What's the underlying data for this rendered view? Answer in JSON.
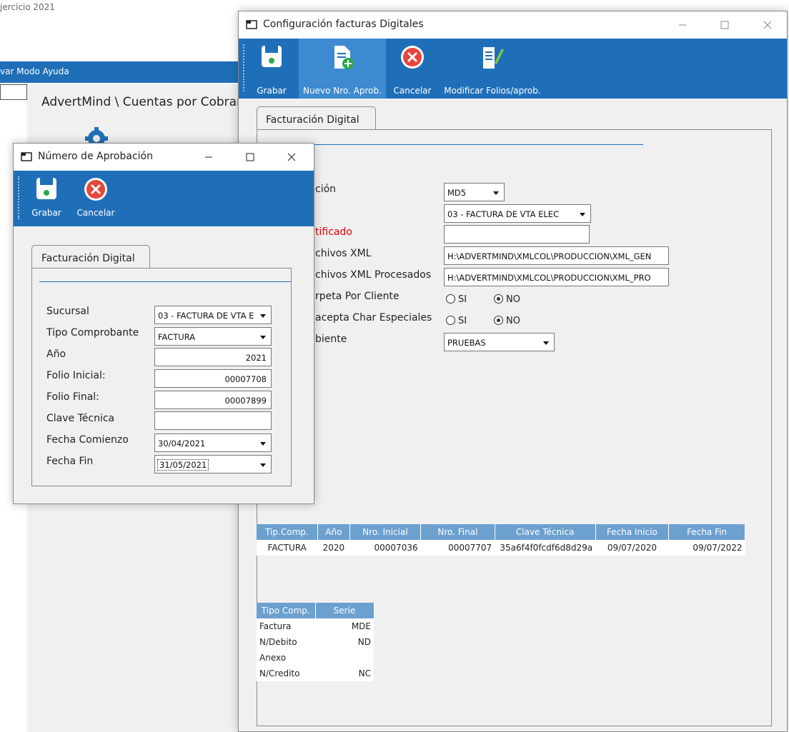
{
  "background_app": {
    "title_fragment": "jercicio 2021",
    "menu_fragment": "var Modo Ayuda",
    "breadcrumb": "AdvertMind \\ Cuentas por Cobrar"
  },
  "config_window": {
    "title": "Configuración facturas Digitales",
    "toolbar": {
      "grabar": "Grabar",
      "nuevo": "Nuevo Nro. Aprob.",
      "cancelar": "Cancelar",
      "modificar": "Modificar Folios/aprob."
    },
    "tab_label": "Facturación Digital",
    "labels": {
      "encriptacion": "ción",
      "certificado": "tificado",
      "archivos_xml": "chivos XML",
      "archivos_xml_procesados": "chivos XML Procesados",
      "carpeta_por_cliente": "rpeta Por Cliente",
      "acepta_char": "acepta Char Especiales",
      "ambiente": "biente"
    },
    "values": {
      "encriptacion": "MD5",
      "sucursal": "03 - FACTURA DE VTA ELEC",
      "certificado": "",
      "archivos_xml": "H:\\ADVERTMIND\\XMLCOL\\PRODUCCION\\XML_GEN",
      "archivos_xml_procesados": "H:\\ADVERTMIND\\XMLCOL\\PRODUCCION\\XML_PRO",
      "si_label": "SI",
      "no_label": "NO",
      "carpeta_por_cliente": "NO",
      "acepta_char": "NO",
      "ambiente": "PRUEBAS"
    },
    "approvals_table": {
      "headers": [
        "Tip.Comp.",
        "Año",
        "Nro. Inicial",
        "Nro. Final",
        "Clave Técnica",
        "Fecha Inicio",
        "Fecha Fin"
      ],
      "rows": [
        [
          "FACTURA",
          "2020",
          "00007036",
          "00007707",
          "35a6f4f0fcdf6d8d29a",
          "09/07/2020",
          "09/07/2022"
        ]
      ]
    },
    "series_table": {
      "headers": [
        "Tipo Comp.",
        "Serie"
      ],
      "rows": [
        [
          "Factura",
          "MDE"
        ],
        [
          "N/Debito",
          "ND"
        ],
        [
          "Anexo",
          ""
        ],
        [
          "N/Credito",
          "NC"
        ]
      ]
    }
  },
  "approval_window": {
    "title": "Número de Aprobación",
    "toolbar": {
      "grabar": "Grabar",
      "cancelar": "Cancelar"
    },
    "tab_label": "Facturación Digital",
    "labels": {
      "sucursal": "Sucursal",
      "tipo_comprobante": "Tipo Comprobante",
      "anio": "Año",
      "folio_inicial": "Folio Inicial:",
      "folio_final": "Folio Final:",
      "clave_tecnica": "Clave Técnica",
      "fecha_comienzo": "Fecha Comienzo",
      "fecha_fin": "Fecha Fin"
    },
    "values": {
      "sucursal": "03 - FACTURA DE VTA E",
      "tipo_comprobante": "FACTURA",
      "anio": "2021",
      "folio_inicial": "00007708",
      "folio_final": "00007899",
      "clave_tecnica": "",
      "fecha_comienzo": "30/04/2021",
      "fecha_fin": "31/05/2021"
    }
  },
  "colors": {
    "toolbar": "#1f6fb8",
    "grid_header": "#6ca0cf",
    "required_label": "#e00000"
  }
}
